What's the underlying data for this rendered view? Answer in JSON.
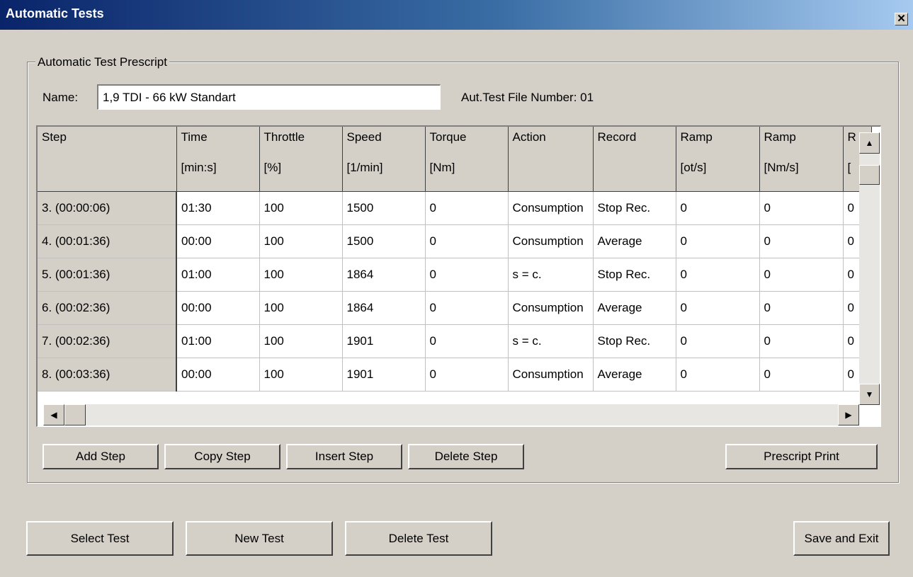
{
  "window": {
    "title": "Automatic Tests",
    "close_glyph": "✕"
  },
  "prescript": {
    "group_title": "Automatic Test Prescript",
    "name_label": "Name:",
    "name_value": "1,9 TDI - 66 kW Standart",
    "file_number_label": "Aut.Test File Number: 01"
  },
  "grid": {
    "headers": [
      "Step",
      "Time",
      "Throttle",
      "Speed",
      "Torque",
      "Action",
      "Record",
      "Ramp",
      "Ramp",
      "R"
    ],
    "units": [
      "",
      "[min:s]",
      "[%]",
      "[1/min]",
      "[Nm]",
      "",
      "",
      "[ot/s]",
      "[Nm/s]",
      "["
    ],
    "rows": [
      [
        "3. (00:00:06)",
        "01:30",
        "100",
        "1500",
        "0",
        "Consumption",
        "Stop Rec.",
        "0",
        "0",
        "0"
      ],
      [
        "4. (00:01:36)",
        "00:00",
        "100",
        "1500",
        "0",
        "Consumption",
        "Average",
        "0",
        "0",
        "0"
      ],
      [
        "5. (00:01:36)",
        "01:00",
        "100",
        "1864",
        "0",
        "s = c.",
        "Stop Rec.",
        "0",
        "0",
        "0"
      ],
      [
        "6. (00:02:36)",
        "00:00",
        "100",
        "1864",
        "0",
        "Consumption",
        "Average",
        "0",
        "0",
        "0"
      ],
      [
        "7. (00:02:36)",
        "01:00",
        "100",
        "1901",
        "0",
        "s = c.",
        "Stop Rec.",
        "0",
        "0",
        "0"
      ],
      [
        "8. (00:03:36)",
        "00:00",
        "100",
        "1901",
        "0",
        "Consumption",
        "Average",
        "0",
        "0",
        "0"
      ]
    ]
  },
  "step_buttons": {
    "add": "Add Step",
    "copy": "Copy Step",
    "insert": "Insert Step",
    "delete": "Delete Step",
    "print": "Prescript Print"
  },
  "test_buttons": {
    "select": "Select Test",
    "new": "New Test",
    "delete": "Delete Test",
    "save_exit": "Save and Exit"
  },
  "icons": {
    "scroll_up": "triangle-up-icon",
    "scroll_down": "triangle-down-icon",
    "scroll_left": "triangle-left-icon",
    "scroll_right": "triangle-right-icon"
  }
}
